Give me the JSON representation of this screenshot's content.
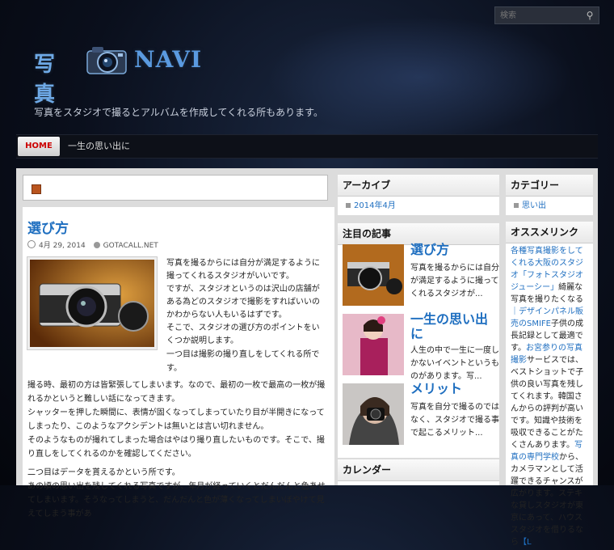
{
  "search": {
    "placeholder": "検索"
  },
  "site": {
    "logo_kanji": "写真",
    "logo_navi": "NAVI",
    "tagline": "写真をスタジオで撮るとアルバムを作成してくれる所もあります。"
  },
  "nav": {
    "home": "HOME",
    "item1": "一生の思い出に"
  },
  "post": {
    "title": "選び方",
    "date": "4月 29, 2014",
    "author": "GOTACALL.NET",
    "para1": "写真を撮るからには自分が満足するように撮ってくれるスタジオがいいです。",
    "para2": "ですが、スタジオというのは沢山の店舗がある為どのスタジオで撮影をすればいいのかわからない人もいるはずです。",
    "para3": "そこで、スタジオの選び方のポイントをいくつか説明します。",
    "para4": "一つ目は撮影の撮り直しをしてくれる所です。",
    "para5": "撮る時、最初の方は皆緊張してしまいます。なので、最初の一枚で最高の一枚が撮れるかというと難しい話になってきます。",
    "para6": "シャッターを押した瞬間に、表情が固くなってしまっていたり目が半開きになってしまったり、このようなアクシデントは無いとは言い切れません。",
    "para7": "そのようなものが撮れてしまった場合はやはり撮り直したいものです。そこで、撮り直しをしてくれるのかを確認してください。",
    "para8": "二つ目はデータを貰えるかという所です。",
    "para9": "あの頃の思い出を残してくれる写真ですが、年月が経っていくとだんだんと色あせてしまいます。そうなってしまうと、だんだんと色が薄くなってしまいぼやけて見えてしまう事があ"
  },
  "archive": {
    "heading": "アーカイブ",
    "item": "2014年4月"
  },
  "category": {
    "heading": "カテゴリー",
    "item": "思い出"
  },
  "featured": {
    "heading": "注目の記事",
    "items": [
      {
        "title": "選び方",
        "excerpt": "写真を撮るからには自分が満足するように撮ってくれるスタジオが..."
      },
      {
        "title": "一生の思い出に",
        "excerpt": "人生の中で一生に一度しかないイベントというものがあります。写..."
      },
      {
        "title": "メリット",
        "excerpt": "写真を自分で撮るのではなく、スタジオで撮る事で起こるメリット..."
      }
    ]
  },
  "calendar": {
    "heading": "カレンダー"
  },
  "recommend": {
    "heading": "オススメリンク",
    "l1": "各種写真撮影をしてくれる大阪のスタジオ「フォトスタジオジューシー」",
    "t1": "綺麗な写真を撮りたくなる",
    "l2": "｜デザインパネル販売のSMIFE",
    "t2": "子供の成長記録として最適です。",
    "l3": "お宮参りの写真撮影",
    "t3": "サービスでは、ベストショットで子供の良い写真を残してくれます。韓国さんからの評判が高いです。",
    "t4": "知識や技術を吸収できることがたくさんあります。",
    "l4": "写真の専門学校",
    "t5": "から、カメラマンとして活躍できるチャンスが広がります。",
    "t6": "ステキな貸しスタジオが東京にあって、ハウススタジオを借りるなら",
    "l5": "【L"
  }
}
